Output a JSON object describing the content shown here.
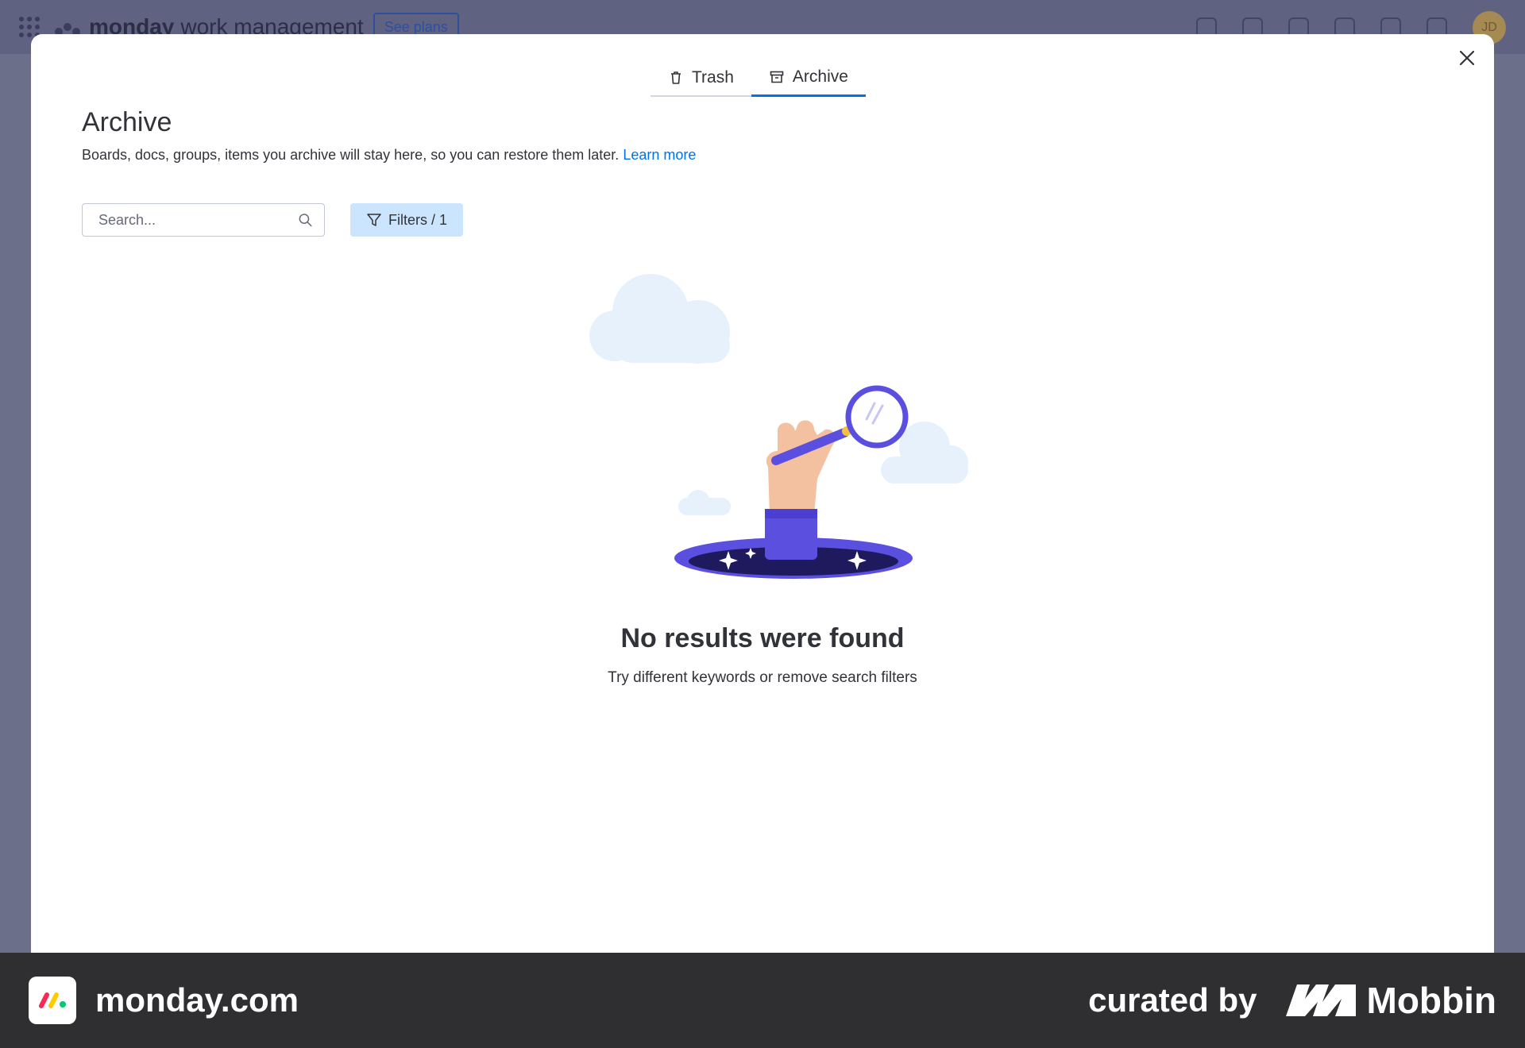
{
  "topbar": {
    "brand_bold": "monday",
    "brand_rest": "work management",
    "see_plans": "See plans",
    "avatar_initials": "JD",
    "icons": [
      "bell-icon",
      "inbox-icon",
      "invite-icon",
      "apps-icon",
      "search-icon",
      "help-icon"
    ]
  },
  "modal": {
    "tabs": [
      {
        "label": "Trash",
        "icon": "trash-icon",
        "active": false
      },
      {
        "label": "Archive",
        "icon": "archive-icon",
        "active": true
      }
    ],
    "title": "Archive",
    "description": "Boards, docs, groups, items you archive will stay here, so you can restore them later.",
    "learn_more": "Learn more",
    "search": {
      "placeholder": "Search...",
      "value": ""
    },
    "filters_label": "Filters / 1",
    "empty_title": "No results were found",
    "empty_subtitle": "Try different keywords or remove search filters"
  },
  "footer": {
    "brand": "monday.com",
    "curated_by": "curated by",
    "mobbin": "Mobbin"
  },
  "colors": {
    "accent": "#0073ea",
    "filters_bg": "#cce5ff",
    "illustration_purple": "#5b4fe0",
    "footer_bg": "#2f2f31"
  }
}
